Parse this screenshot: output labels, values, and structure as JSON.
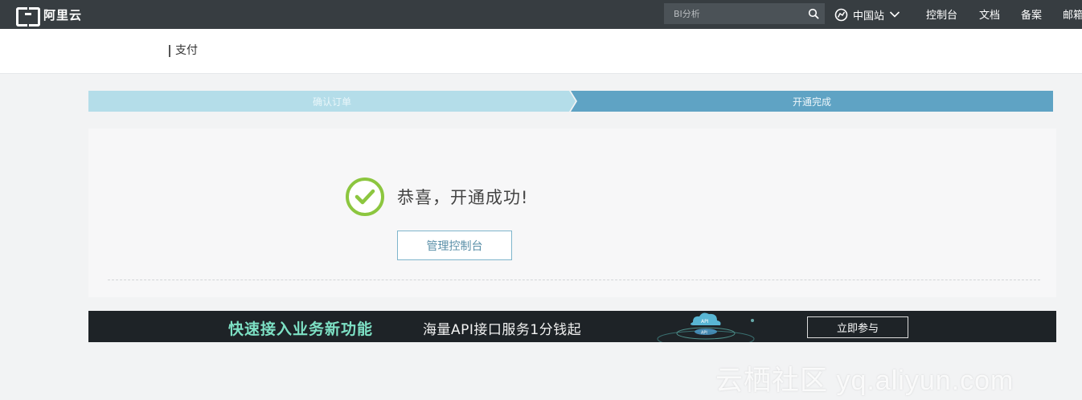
{
  "header": {
    "logo_text": "阿里云",
    "search": {
      "placeholder": "BI分析"
    },
    "region": "中国站",
    "nav": [
      "控制台",
      "文档",
      "备案",
      "邮箱"
    ]
  },
  "subheader": {
    "title": "支付"
  },
  "steps": [
    {
      "label": "确认订单",
      "state": "done"
    },
    {
      "label": "开通完成",
      "state": "active"
    }
  ],
  "result": {
    "message": "恭喜，开通成功!",
    "console_button": "管理控制台"
  },
  "banner": {
    "title": "快速接入业务新功能",
    "subtitle": "海量API接口服务1分钱起",
    "graphic_label": "API",
    "button": "立即参与"
  },
  "watermark": "云栖社区 yq.aliyun.com",
  "colors": {
    "topbar": "#373d41",
    "step_done": "#b4dde9",
    "step_active": "#5fa3c4",
    "success_green": "#8cc63f",
    "banner_bg": "#1e2327",
    "banner_accent": "#7de0c4"
  }
}
